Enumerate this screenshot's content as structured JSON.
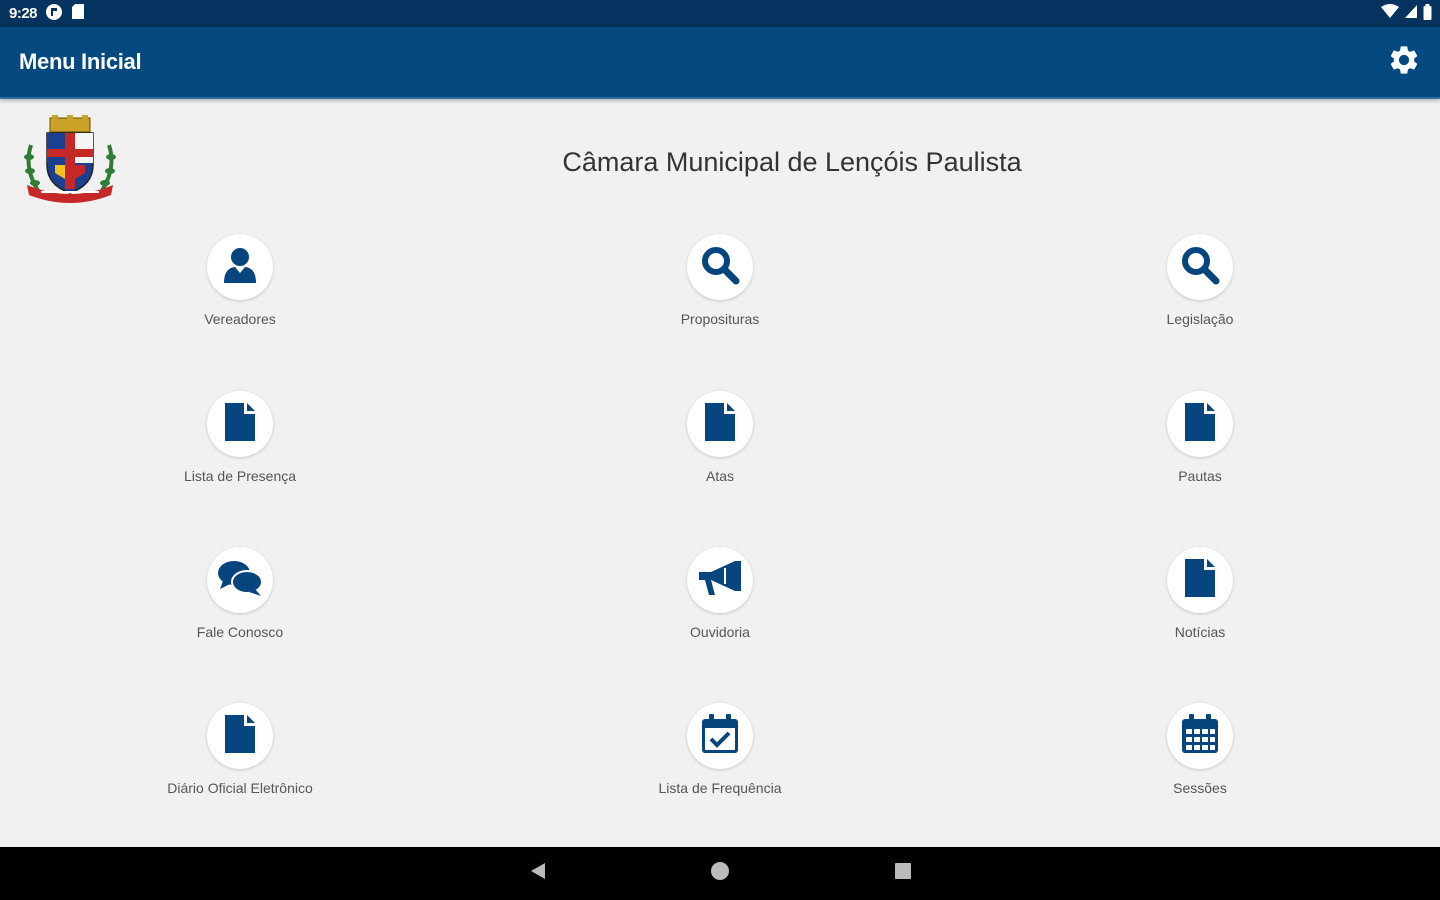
{
  "status_bar": {
    "time": "9:28",
    "icons": [
      "app-notification-icon",
      "sd-card-icon",
      "wifi-icon",
      "signal-icon",
      "battery-icon"
    ]
  },
  "app_bar": {
    "title": "Menu Inicial",
    "settings_icon": "gear-icon"
  },
  "header": {
    "title": "Câmara Municipal de Lençóis Paulista",
    "crest": "coat-of-arms"
  },
  "menu": {
    "items": [
      {
        "label": "Vereadores",
        "icon": "person-icon"
      },
      {
        "label": "Proposituras",
        "icon": "search-icon"
      },
      {
        "label": "Legislação",
        "icon": "search-icon"
      },
      {
        "label": "Lista de Presença",
        "icon": "document-icon"
      },
      {
        "label": "Atas",
        "icon": "document-icon"
      },
      {
        "label": "Pautas",
        "icon": "document-icon"
      },
      {
        "label": "Fale Conosco",
        "icon": "chat-bubbles-icon"
      },
      {
        "label": "Ouvidoria",
        "icon": "megaphone-icon"
      },
      {
        "label": "Notícias",
        "icon": "document-icon"
      },
      {
        "label": "Diário Oficial Eletrônico",
        "icon": "document-icon"
      },
      {
        "label": "Lista de Frequência",
        "icon": "calendar-check-icon"
      },
      {
        "label": "Sessões",
        "icon": "calendar-icon"
      }
    ]
  },
  "nav_bar": {
    "buttons": [
      "back-icon",
      "home-icon",
      "recents-icon"
    ]
  },
  "colors": {
    "status_bar": "#03335e",
    "app_bar": "#044a80",
    "icon": "#07457f",
    "background": "#f1f1f1"
  }
}
